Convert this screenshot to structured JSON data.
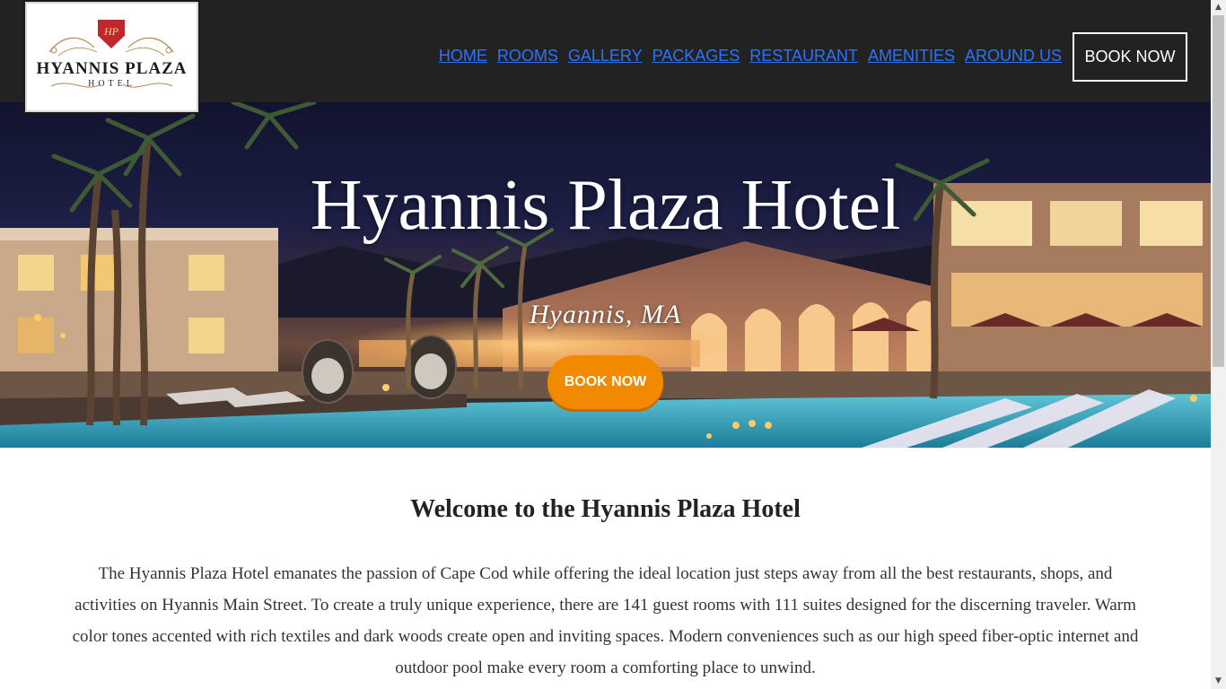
{
  "header": {
    "logo": {
      "title": "HYANNIS PLAZA",
      "subtitle": "HOTEL",
      "monogram": "HP"
    },
    "nav": [
      {
        "label": "HOME"
      },
      {
        "label": "ROOMS"
      },
      {
        "label": "GALLERY"
      },
      {
        "label": "PACKAGES"
      },
      {
        "label": "RESTAURANT"
      },
      {
        "label": "AMENITIES"
      },
      {
        "label": "AROUND US"
      }
    ],
    "book_label": "BOOK NOW"
  },
  "hero": {
    "title": "Hyannis Plaza Hotel",
    "subtitle": "Hyannis, MA",
    "book_label": "BOOK NOW"
  },
  "welcome": {
    "title": "Welcome to the Hyannis Plaza Hotel",
    "text": "The Hyannis Plaza Hotel emanates the passion of Cape Cod while offering the ideal location just steps away from all the best restaurants, shops, and activities on Hyannis Main Street. To create a truly unique experience, there are 141 guest rooms with 111 suites designed for the discerning traveler. Warm color tones accented with rich textiles and dark woods create open and inviting spaces. Modern conveniences such as our high speed fiber-optic internet and outdoor pool make every room a comforting place to unwind."
  },
  "colors": {
    "header_bg": "#222222",
    "nav_link": "#2b73ff",
    "accent_button": "#f28a00",
    "logo_shield": "#c0272d"
  }
}
